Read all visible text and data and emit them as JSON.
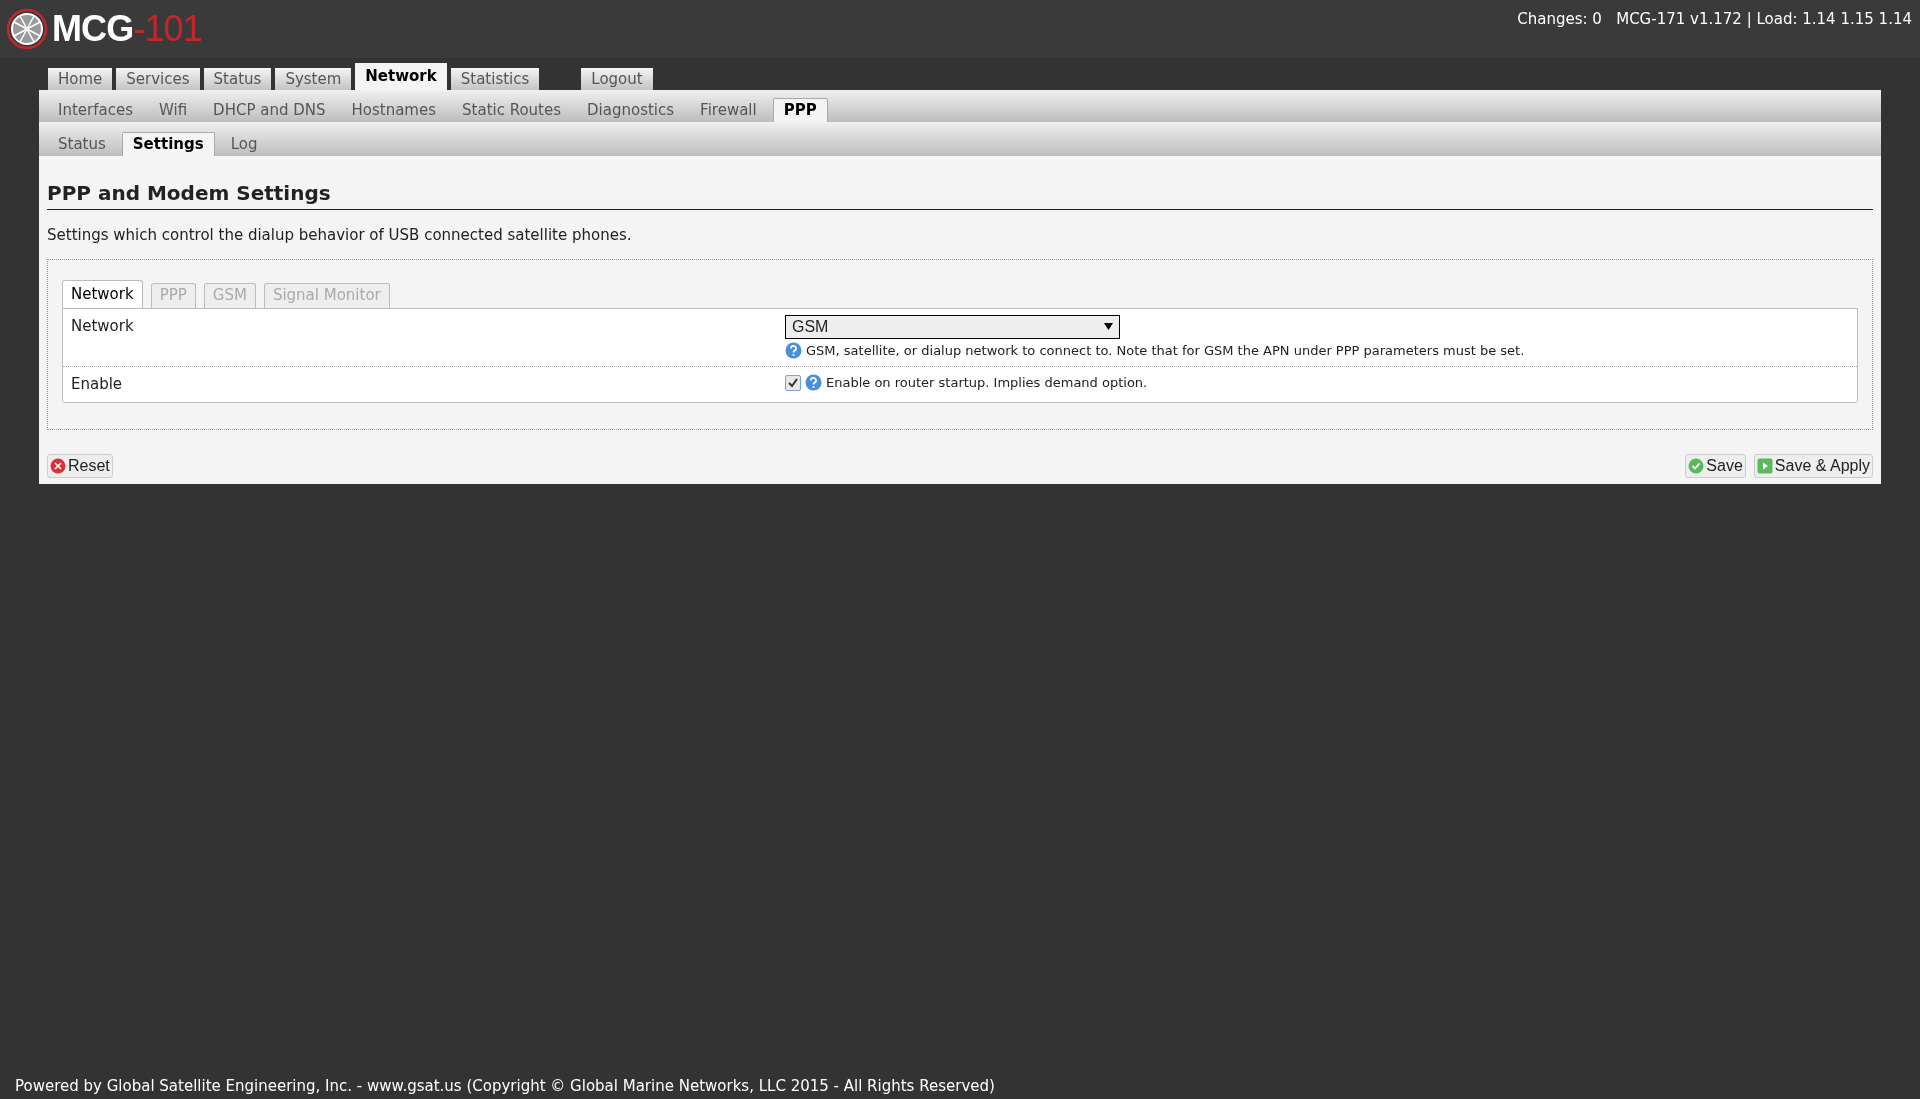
{
  "header": {
    "logo_name": "MCG",
    "logo_suffix": "-101",
    "status": "Changes: 0   MCG-171 v1.172 | Load: 1.14 1.15 1.14"
  },
  "main_tabs": [
    {
      "label": "Home",
      "selected": false
    },
    {
      "label": "Services",
      "selected": false
    },
    {
      "label": "Status",
      "selected": false
    },
    {
      "label": "System",
      "selected": false
    },
    {
      "label": "Network",
      "selected": true
    },
    {
      "label": "Statistics",
      "selected": false
    },
    {
      "label": "Logout",
      "selected": false,
      "kind": "separate"
    }
  ],
  "sub_tabs": [
    {
      "label": "Interfaces",
      "selected": false
    },
    {
      "label": "Wifi",
      "selected": false
    },
    {
      "label": "DHCP and DNS",
      "selected": false
    },
    {
      "label": "Hostnames",
      "selected": false
    },
    {
      "label": "Static Routes",
      "selected": false
    },
    {
      "label": "Diagnostics",
      "selected": false
    },
    {
      "label": "Firewall",
      "selected": false
    },
    {
      "label": "PPP",
      "selected": true
    }
  ],
  "page_tabs": [
    {
      "label": "Status",
      "selected": false
    },
    {
      "label": "Settings",
      "selected": true
    },
    {
      "label": "Log",
      "selected": false
    }
  ],
  "title": "PPP and Modem Settings",
  "description": "Settings which control the dialup behavior of USB connected satellite phones.",
  "section_tabs": [
    {
      "label": "Network",
      "selected": true
    },
    {
      "label": "PPP",
      "selected": false
    },
    {
      "label": "GSM",
      "selected": false
    },
    {
      "label": "Signal Monitor",
      "selected": false
    }
  ],
  "fields": [
    {
      "kind": "select",
      "label": "Network",
      "value": "GSM",
      "help": "GSM, satellite, or dialup network to connect to. Note that for GSM the APN under PPP parameters must be set."
    },
    {
      "kind": "checkbox",
      "label": "Enable",
      "checked": true,
      "help": "Enable on router startup. Implies demand option."
    }
  ],
  "buttons": {
    "reset": "Reset",
    "save": "Save",
    "save_apply": "Save & Apply"
  },
  "footer": "Powered by Global Satellite Engineering, Inc. - www.gsat.us (Copyright © Global Marine Networks, LLC 2015 - All Rights Reserved)"
}
